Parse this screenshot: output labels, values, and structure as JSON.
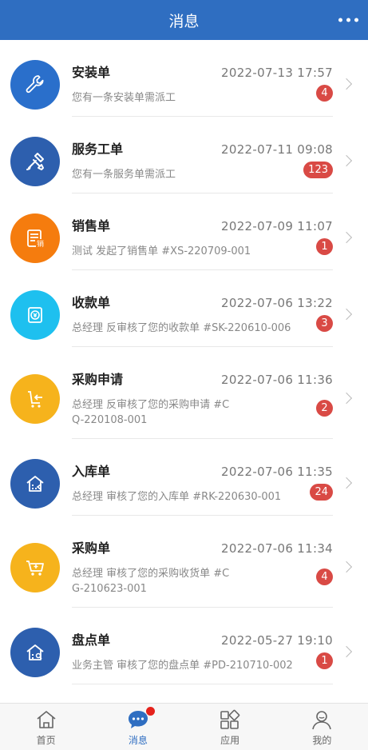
{
  "header": {
    "title": "消息"
  },
  "messages": [
    {
      "title": "安装单",
      "time": "2022-07-13 17:57",
      "desc": "您有一条安装单需派工",
      "badge": "4",
      "icon": "wrench-icon",
      "color": "#2a6fcb"
    },
    {
      "title": "服务工单",
      "time": "2022-07-11 09:08",
      "desc": "您有一条服务单需派工",
      "badge": "123",
      "icon": "tools-icon",
      "color": "#2d5fae"
    },
    {
      "title": "销售单",
      "time": "2022-07-09 11:07",
      "desc": "测试 发起了销售单 #XS-220709-001",
      "badge": "1",
      "icon": "sales-doc-icon",
      "color": "#f57c0e"
    },
    {
      "title": "收款单",
      "time": "2022-07-06 13:22",
      "desc": "总经理 反审核了您的收款单 #SK-220610-006",
      "badge": "3",
      "icon": "payment-icon",
      "color": "#1ec0ef"
    },
    {
      "title": "采购申请",
      "time": "2022-07-06 11:36",
      "desc": "总经理 反审核了您的采购申请 #CQ-220108-001",
      "badge": "2",
      "icon": "purchase-request-icon",
      "color": "#f6b31c"
    },
    {
      "title": "入库单",
      "time": "2022-07-06 11:35",
      "desc": "总经理 审核了您的入库单 #RK-220630-001",
      "badge": "24",
      "icon": "warehouse-in-icon",
      "color": "#2d5fae"
    },
    {
      "title": "采购单",
      "time": "2022-07-06 11:34",
      "desc": "总经理 审核了您的采购收货单 #CG-210623-001",
      "badge": "4",
      "icon": "cart-icon",
      "color": "#f6b31c"
    },
    {
      "title": "盘点单",
      "time": "2022-05-27 19:10",
      "desc": "业务主管 审核了您的盘点单 #PD-210710-002",
      "badge": "1",
      "icon": "inventory-icon",
      "color": "#2d5fae"
    }
  ],
  "tabbar": {
    "items": [
      {
        "label": "首页",
        "icon": "home-icon"
      },
      {
        "label": "消息",
        "icon": "chat-icon",
        "active": true
      },
      {
        "label": "应用",
        "icon": "apps-icon"
      },
      {
        "label": "我的",
        "icon": "profile-icon"
      }
    ]
  }
}
